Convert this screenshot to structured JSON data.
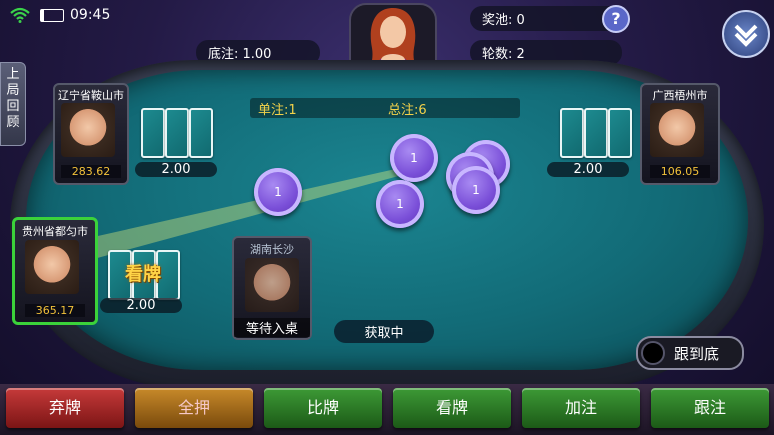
{
  "status": {
    "time": "09:45"
  },
  "header": {
    "prize_pool_label": "奖池: 0",
    "round_label": "轮数: 2",
    "base_bet_label": "底注: 1.00",
    "help_glyph": "?"
  },
  "side_tab": {
    "label": "上局回顾"
  },
  "table_info": {
    "single_bet": "单注:1",
    "total_bet": "总注:6"
  },
  "players": [
    {
      "name": "辽宁省鞍山市",
      "money": "283.62",
      "bet": "2.00"
    },
    {
      "name": "广西梧州市",
      "money": "106.05",
      "bet": "2.00"
    },
    {
      "name": "贵州省都匀市",
      "money": "365.17",
      "bet": "2.00",
      "card_status": "看牌"
    },
    {
      "name": "湖南长沙",
      "status": "等待入桌"
    }
  ],
  "chips": [
    "1",
    "1",
    "1",
    "1",
    "1",
    "1"
  ],
  "center_status": "获取中",
  "follow_toggle": {
    "label": "跟到底"
  },
  "actions": [
    "弃牌",
    "全押",
    "比牌",
    "看牌",
    "加注",
    "跟注"
  ],
  "colors": {
    "felt": "#126b77",
    "chip": "#7a4fd8",
    "money": "#f3c23a"
  }
}
